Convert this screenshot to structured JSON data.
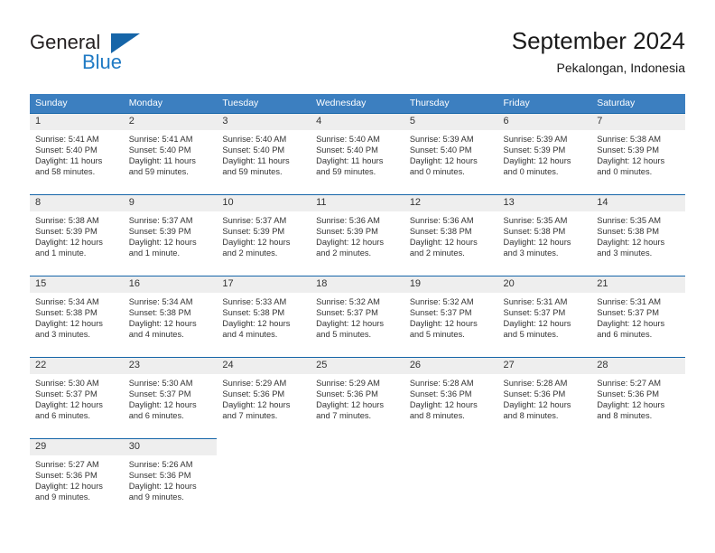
{
  "brand": {
    "name_part1": "General",
    "name_part2": "Blue",
    "triangle_color": "#1665a8",
    "blue_color": "#1f7ac4"
  },
  "header": {
    "title": "September 2024",
    "subtitle": "Pekalongan, Indonesia"
  },
  "theme": {
    "header_bg": "#3c7fc0",
    "cell_border": "#1565a8",
    "daynum_bg": "#eeeeee"
  },
  "weekdays": [
    "Sunday",
    "Monday",
    "Tuesday",
    "Wednesday",
    "Thursday",
    "Friday",
    "Saturday"
  ],
  "weeks": [
    [
      {
        "day": "1",
        "sunrise": "Sunrise: 5:41 AM",
        "sunset": "Sunset: 5:40 PM",
        "daylight1": "Daylight: 11 hours",
        "daylight2": "and 58 minutes."
      },
      {
        "day": "2",
        "sunrise": "Sunrise: 5:41 AM",
        "sunset": "Sunset: 5:40 PM",
        "daylight1": "Daylight: 11 hours",
        "daylight2": "and 59 minutes."
      },
      {
        "day": "3",
        "sunrise": "Sunrise: 5:40 AM",
        "sunset": "Sunset: 5:40 PM",
        "daylight1": "Daylight: 11 hours",
        "daylight2": "and 59 minutes."
      },
      {
        "day": "4",
        "sunrise": "Sunrise: 5:40 AM",
        "sunset": "Sunset: 5:40 PM",
        "daylight1": "Daylight: 11 hours",
        "daylight2": "and 59 minutes."
      },
      {
        "day": "5",
        "sunrise": "Sunrise: 5:39 AM",
        "sunset": "Sunset: 5:40 PM",
        "daylight1": "Daylight: 12 hours",
        "daylight2": "and 0 minutes."
      },
      {
        "day": "6",
        "sunrise": "Sunrise: 5:39 AM",
        "sunset": "Sunset: 5:39 PM",
        "daylight1": "Daylight: 12 hours",
        "daylight2": "and 0 minutes."
      },
      {
        "day": "7",
        "sunrise": "Sunrise: 5:38 AM",
        "sunset": "Sunset: 5:39 PM",
        "daylight1": "Daylight: 12 hours",
        "daylight2": "and 0 minutes."
      }
    ],
    [
      {
        "day": "8",
        "sunrise": "Sunrise: 5:38 AM",
        "sunset": "Sunset: 5:39 PM",
        "daylight1": "Daylight: 12 hours",
        "daylight2": "and 1 minute."
      },
      {
        "day": "9",
        "sunrise": "Sunrise: 5:37 AM",
        "sunset": "Sunset: 5:39 PM",
        "daylight1": "Daylight: 12 hours",
        "daylight2": "and 1 minute."
      },
      {
        "day": "10",
        "sunrise": "Sunrise: 5:37 AM",
        "sunset": "Sunset: 5:39 PM",
        "daylight1": "Daylight: 12 hours",
        "daylight2": "and 2 minutes."
      },
      {
        "day": "11",
        "sunrise": "Sunrise: 5:36 AM",
        "sunset": "Sunset: 5:39 PM",
        "daylight1": "Daylight: 12 hours",
        "daylight2": "and 2 minutes."
      },
      {
        "day": "12",
        "sunrise": "Sunrise: 5:36 AM",
        "sunset": "Sunset: 5:38 PM",
        "daylight1": "Daylight: 12 hours",
        "daylight2": "and 2 minutes."
      },
      {
        "day": "13",
        "sunrise": "Sunrise: 5:35 AM",
        "sunset": "Sunset: 5:38 PM",
        "daylight1": "Daylight: 12 hours",
        "daylight2": "and 3 minutes."
      },
      {
        "day": "14",
        "sunrise": "Sunrise: 5:35 AM",
        "sunset": "Sunset: 5:38 PM",
        "daylight1": "Daylight: 12 hours",
        "daylight2": "and 3 minutes."
      }
    ],
    [
      {
        "day": "15",
        "sunrise": "Sunrise: 5:34 AM",
        "sunset": "Sunset: 5:38 PM",
        "daylight1": "Daylight: 12 hours",
        "daylight2": "and 3 minutes."
      },
      {
        "day": "16",
        "sunrise": "Sunrise: 5:34 AM",
        "sunset": "Sunset: 5:38 PM",
        "daylight1": "Daylight: 12 hours",
        "daylight2": "and 4 minutes."
      },
      {
        "day": "17",
        "sunrise": "Sunrise: 5:33 AM",
        "sunset": "Sunset: 5:38 PM",
        "daylight1": "Daylight: 12 hours",
        "daylight2": "and 4 minutes."
      },
      {
        "day": "18",
        "sunrise": "Sunrise: 5:32 AM",
        "sunset": "Sunset: 5:37 PM",
        "daylight1": "Daylight: 12 hours",
        "daylight2": "and 5 minutes."
      },
      {
        "day": "19",
        "sunrise": "Sunrise: 5:32 AM",
        "sunset": "Sunset: 5:37 PM",
        "daylight1": "Daylight: 12 hours",
        "daylight2": "and 5 minutes."
      },
      {
        "day": "20",
        "sunrise": "Sunrise: 5:31 AM",
        "sunset": "Sunset: 5:37 PM",
        "daylight1": "Daylight: 12 hours",
        "daylight2": "and 5 minutes."
      },
      {
        "day": "21",
        "sunrise": "Sunrise: 5:31 AM",
        "sunset": "Sunset: 5:37 PM",
        "daylight1": "Daylight: 12 hours",
        "daylight2": "and 6 minutes."
      }
    ],
    [
      {
        "day": "22",
        "sunrise": "Sunrise: 5:30 AM",
        "sunset": "Sunset: 5:37 PM",
        "daylight1": "Daylight: 12 hours",
        "daylight2": "and 6 minutes."
      },
      {
        "day": "23",
        "sunrise": "Sunrise: 5:30 AM",
        "sunset": "Sunset: 5:37 PM",
        "daylight1": "Daylight: 12 hours",
        "daylight2": "and 6 minutes."
      },
      {
        "day": "24",
        "sunrise": "Sunrise: 5:29 AM",
        "sunset": "Sunset: 5:36 PM",
        "daylight1": "Daylight: 12 hours",
        "daylight2": "and 7 minutes."
      },
      {
        "day": "25",
        "sunrise": "Sunrise: 5:29 AM",
        "sunset": "Sunset: 5:36 PM",
        "daylight1": "Daylight: 12 hours",
        "daylight2": "and 7 minutes."
      },
      {
        "day": "26",
        "sunrise": "Sunrise: 5:28 AM",
        "sunset": "Sunset: 5:36 PM",
        "daylight1": "Daylight: 12 hours",
        "daylight2": "and 8 minutes."
      },
      {
        "day": "27",
        "sunrise": "Sunrise: 5:28 AM",
        "sunset": "Sunset: 5:36 PM",
        "daylight1": "Daylight: 12 hours",
        "daylight2": "and 8 minutes."
      },
      {
        "day": "28",
        "sunrise": "Sunrise: 5:27 AM",
        "sunset": "Sunset: 5:36 PM",
        "daylight1": "Daylight: 12 hours",
        "daylight2": "and 8 minutes."
      }
    ],
    [
      {
        "day": "29",
        "sunrise": "Sunrise: 5:27 AM",
        "sunset": "Sunset: 5:36 PM",
        "daylight1": "Daylight: 12 hours",
        "daylight2": "and 9 minutes."
      },
      {
        "day": "30",
        "sunrise": "Sunrise: 5:26 AM",
        "sunset": "Sunset: 5:36 PM",
        "daylight1": "Daylight: 12 hours",
        "daylight2": "and 9 minutes."
      },
      {
        "day": "",
        "sunrise": "",
        "sunset": "",
        "daylight1": "",
        "daylight2": ""
      },
      {
        "day": "",
        "sunrise": "",
        "sunset": "",
        "daylight1": "",
        "daylight2": ""
      },
      {
        "day": "",
        "sunrise": "",
        "sunset": "",
        "daylight1": "",
        "daylight2": ""
      },
      {
        "day": "",
        "sunrise": "",
        "sunset": "",
        "daylight1": "",
        "daylight2": ""
      },
      {
        "day": "",
        "sunrise": "",
        "sunset": "",
        "daylight1": "",
        "daylight2": ""
      }
    ]
  ]
}
